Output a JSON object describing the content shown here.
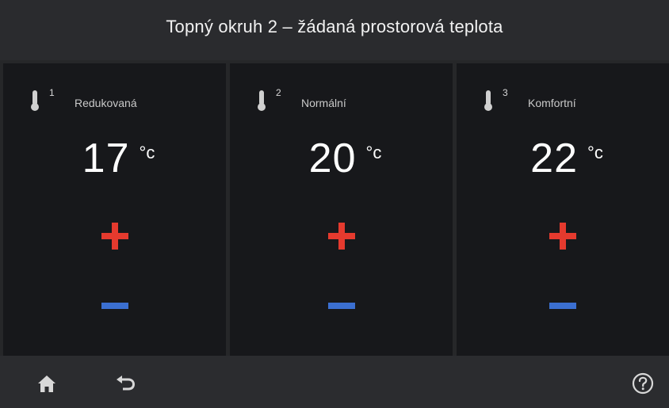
{
  "header": {
    "title": "Topný okruh 2 – žádaná prostorová teplota"
  },
  "panels": [
    {
      "index": "1",
      "label": "Redukovaná",
      "value": "17",
      "unit": "°c"
    },
    {
      "index": "2",
      "label": "Normální",
      "value": "20",
      "unit": "°c"
    },
    {
      "index": "3",
      "label": "Komfortní",
      "value": "22",
      "unit": "°c"
    }
  ],
  "icons": {
    "thermometer": "thermometer-icon",
    "plus": "plus-icon",
    "minus": "minus-icon",
    "home": "home-icon",
    "back": "back-icon",
    "help": "help-icon"
  },
  "colors": {
    "plus": "#e53a2e",
    "minus": "#3b6fd1",
    "header_bg": "#2a2b2e",
    "panel_bg": "#17181b"
  }
}
